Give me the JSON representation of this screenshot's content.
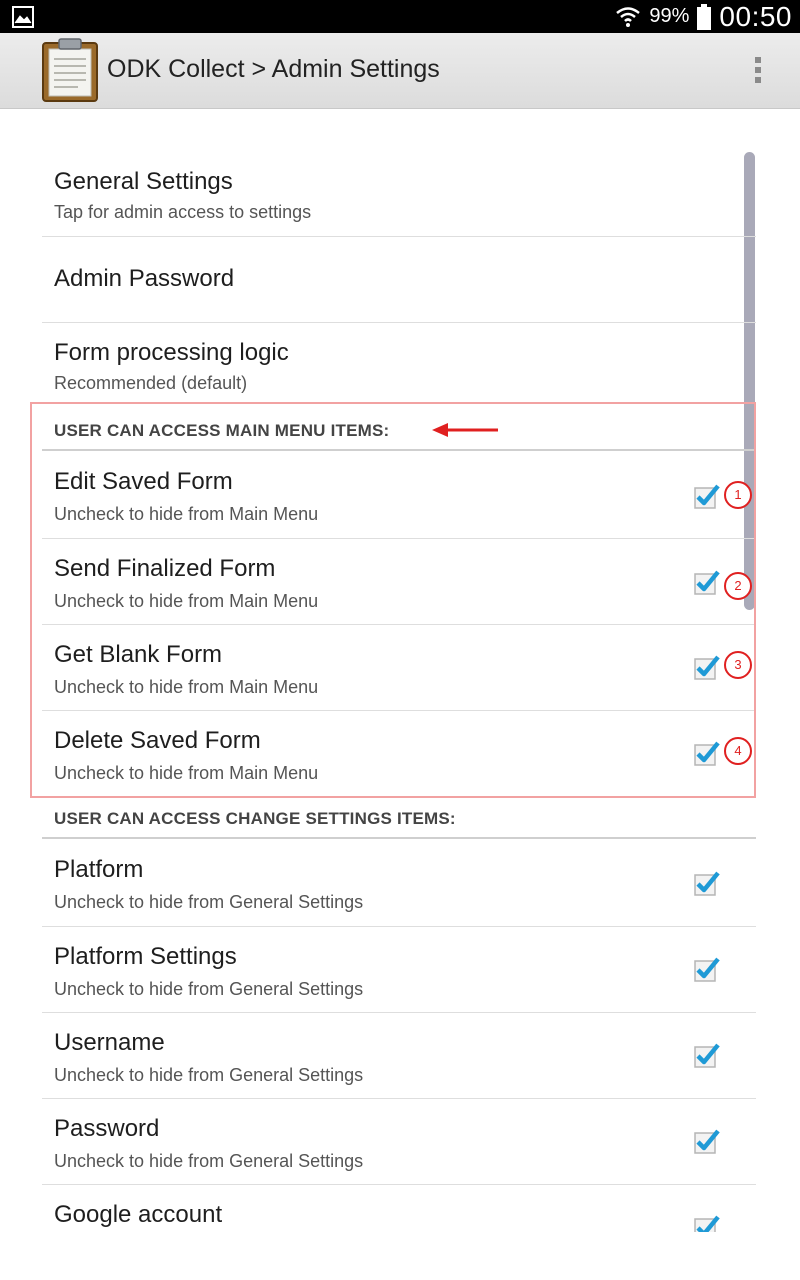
{
  "status_bar": {
    "battery_text": "99%",
    "time": "00:50",
    "icons": [
      "gallery-icon",
      "wifi-icon",
      "battery-icon"
    ]
  },
  "action_bar": {
    "title": "ODK Collect > Admin Settings",
    "icon": "clipboard-icon",
    "menu_icon": "overflow-menu-icon"
  },
  "prefs_top": [
    {
      "title": "General Settings",
      "summary": "Tap for admin access to settings"
    },
    {
      "title": "Admin Password",
      "summary": ""
    },
    {
      "title": "Form processing logic",
      "summary": "Recommended (default)"
    }
  ],
  "main_menu": {
    "heading": "USER CAN ACCESS MAIN MENU ITEMS:",
    "items": [
      {
        "title": "Edit Saved Form",
        "summary": "Uncheck to hide from Main Menu",
        "checked": true,
        "badge": "1"
      },
      {
        "title": "Send Finalized Form",
        "summary": "Uncheck to hide from Main Menu",
        "checked": true,
        "badge": "2"
      },
      {
        "title": "Get Blank Form",
        "summary": "Uncheck to hide from Main Menu",
        "checked": true,
        "badge": "3"
      },
      {
        "title": "Delete Saved Form",
        "summary": "Uncheck to hide from Main Menu",
        "checked": true,
        "badge": "4"
      }
    ]
  },
  "change_settings": {
    "heading": "USER CAN ACCESS CHANGE SETTINGS ITEMS:",
    "items": [
      {
        "title": "Platform",
        "summary": "Uncheck to hide from General Settings",
        "checked": true
      },
      {
        "title": "Platform Settings",
        "summary": "Uncheck to hide from General Settings",
        "checked": true
      },
      {
        "title": "Username",
        "summary": "Uncheck to hide from General Settings",
        "checked": true
      },
      {
        "title": "Password",
        "summary": "Uncheck to hide from General Settings",
        "checked": true
      },
      {
        "title": "Google account",
        "summary": "",
        "checked": true
      }
    ]
  },
  "colors": {
    "checkmark": "#1f9ad6",
    "annotation": "#e02020"
  }
}
